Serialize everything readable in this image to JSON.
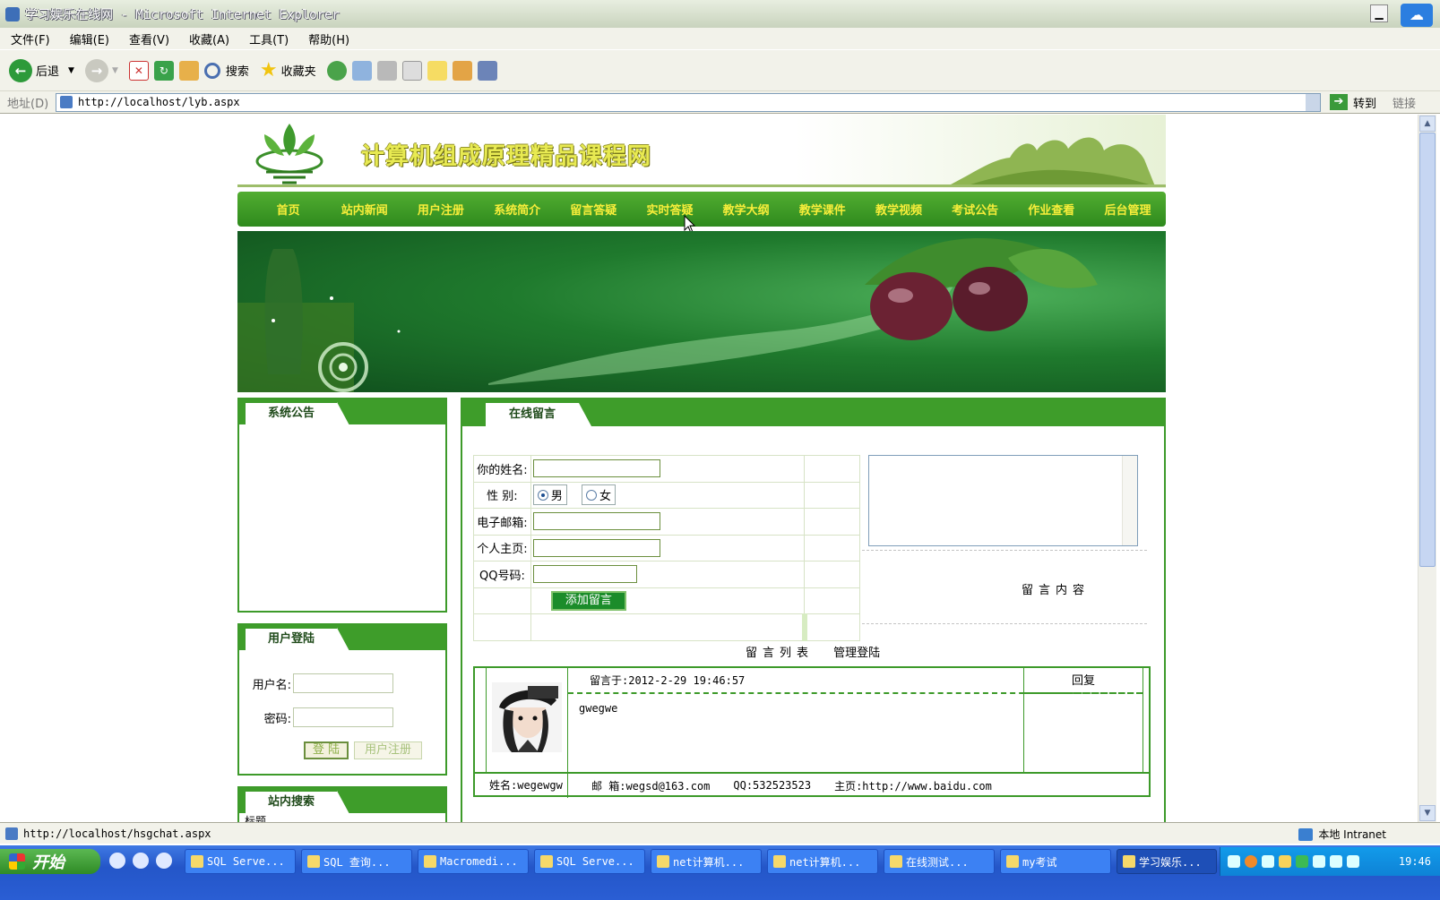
{
  "window": {
    "title": "学习娱乐在线网 - Microsoft Internet Explorer",
    "minimize_icon": "minimize-icon"
  },
  "menu": [
    "文件(F)",
    "编辑(E)",
    "查看(V)",
    "收藏(A)",
    "工具(T)",
    "帮助(H)"
  ],
  "toolbar": {
    "back": "后退",
    "search": "搜索",
    "favorites": "收藏夹"
  },
  "address": {
    "label": "地址(D)",
    "url": "http://localhost/lyb.aspx",
    "go": "转到",
    "links": "链接"
  },
  "site": {
    "title": "计算机组成原理精品课程网",
    "nav": [
      "首页",
      "站内新闻",
      "用户注册",
      "系统简介",
      "留言答疑",
      "实时答疑",
      "教学大纲",
      "教学课件",
      "教学视频",
      "考试公告",
      "作业查看",
      "后台管理"
    ]
  },
  "left": {
    "notice_title": "系统公告",
    "login_title": "用户登陆",
    "username_label": "用户名:",
    "password_label": "密码:",
    "login_button": "登 陆",
    "register_button": "用户注册",
    "search_title": "站内搜索",
    "search_label_partial": "标题"
  },
  "guestbook": {
    "title": "在线留言",
    "name_label": "你的姓名:",
    "gender_label": "性  别:",
    "gender_options": [
      "男",
      "女"
    ],
    "gender_selected": "男",
    "email_label": "电子邮箱:",
    "homepage_label": "个人主页:",
    "qq_label": "QQ号码:",
    "submit": "添加留言",
    "content_label": "留言内容",
    "list_label": "留言列表",
    "admin_login": "管理登陆"
  },
  "message": {
    "posted": "留言于:2012-2-29 19:46:57",
    "reply": "回复",
    "body": "gwegwe",
    "name": "姓名:wegewgw",
    "email": "邮 箱:wegsd@163.com",
    "qq": "QQ:532523523",
    "homepage": "主页:http://www.baidu.com"
  },
  "status": {
    "url": "http://localhost/hsgchat.aspx",
    "zone": "本地 Intranet"
  },
  "taskbar": {
    "start": "开始",
    "tasks": [
      "SQL Serve...",
      "SQL 查询...",
      "Macromedi...",
      "SQL Serve...",
      "net计算机...",
      "net计算机...",
      "在线测试...",
      "my考试",
      "学习娱乐..."
    ],
    "active_task": "学习娱乐...",
    "clock": "19:46"
  }
}
